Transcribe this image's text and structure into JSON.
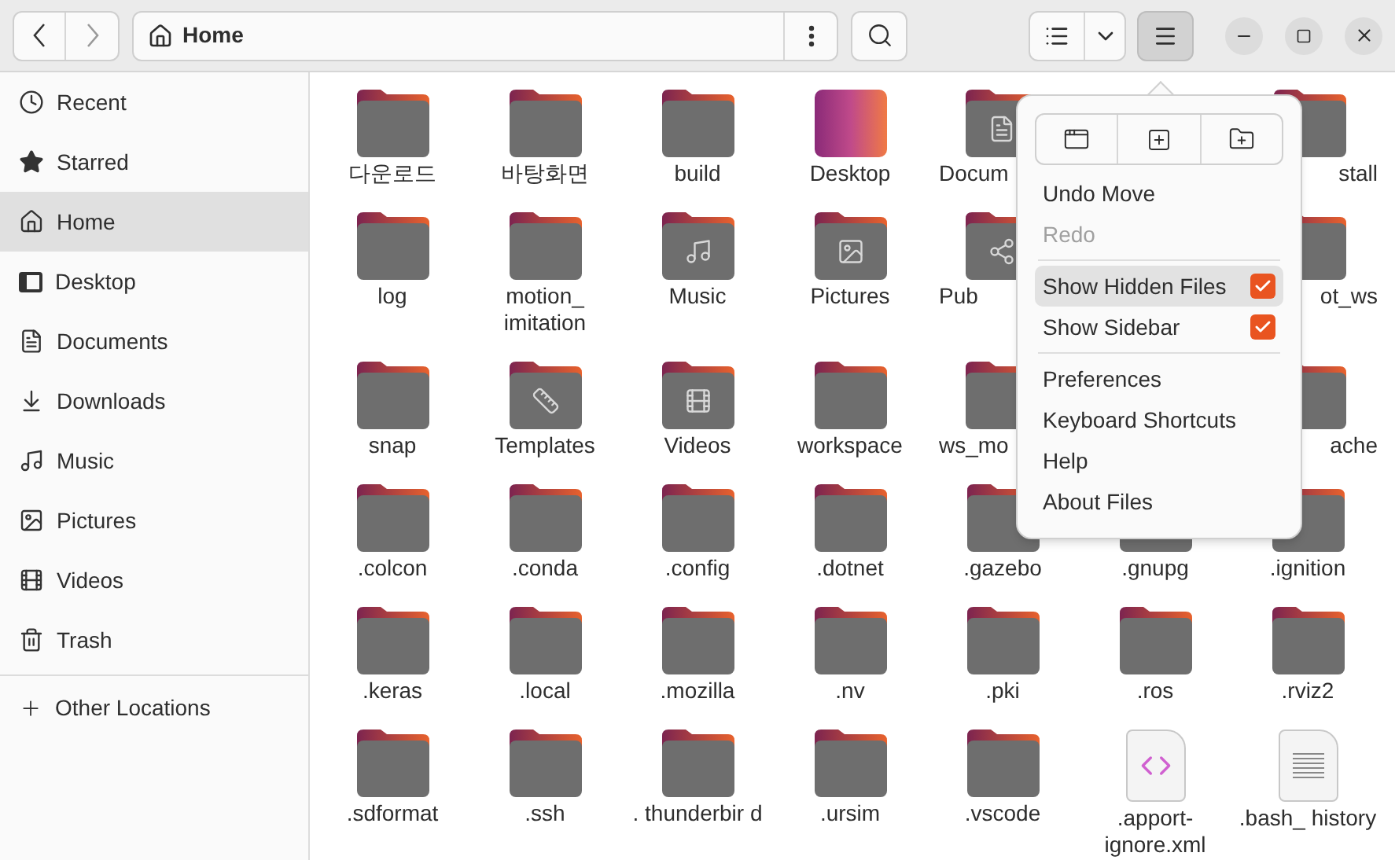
{
  "header": {
    "location": "Home",
    "menu_open": true
  },
  "sidebar": {
    "items": [
      {
        "label": "Recent",
        "kind": "recent",
        "selected": false
      },
      {
        "label": "Starred",
        "kind": "star",
        "selected": false
      },
      {
        "label": "Home",
        "kind": "home",
        "selected": true
      },
      {
        "label": "Desktop",
        "kind": "desktop",
        "selected": false
      },
      {
        "label": "Documents",
        "kind": "document",
        "selected": false
      },
      {
        "label": "Downloads",
        "kind": "download",
        "selected": false
      },
      {
        "label": "Music",
        "kind": "music",
        "selected": false
      },
      {
        "label": "Pictures",
        "kind": "picture",
        "selected": false
      },
      {
        "label": "Videos",
        "kind": "video",
        "selected": false
      },
      {
        "label": "Trash",
        "kind": "trash",
        "selected": false
      }
    ],
    "other": {
      "label": "Other Locations"
    }
  },
  "files": [
    {
      "name": "다운로드",
      "kind": "folder"
    },
    {
      "name": "바탕화면",
      "kind": "folder"
    },
    {
      "name": "build",
      "kind": "folder"
    },
    {
      "name": "Desktop",
      "kind": "desktop"
    },
    {
      "name": "Docum",
      "kind": "folder-document"
    },
    {
      "name": "stall",
      "kind": "folder"
    },
    {
      "name": "log",
      "kind": "folder"
    },
    {
      "name": "motion_ imitation",
      "kind": "folder"
    },
    {
      "name": "Music",
      "kind": "folder-music"
    },
    {
      "name": "Pictures",
      "kind": "folder-picture"
    },
    {
      "name": "Pub",
      "kind": "folder-share"
    },
    {
      "name": "ot_ws",
      "kind": "folder"
    },
    {
      "name": "snap",
      "kind": "folder"
    },
    {
      "name": "Templates",
      "kind": "folder-template"
    },
    {
      "name": "Videos",
      "kind": "folder-video"
    },
    {
      "name": "workspace",
      "kind": "folder"
    },
    {
      "name": "ws_mo",
      "kind": "folder"
    },
    {
      "name": "ache",
      "kind": "folder"
    },
    {
      "name": ".colcon",
      "kind": "folder"
    },
    {
      "name": ".conda",
      "kind": "folder"
    },
    {
      "name": ".config",
      "kind": "folder"
    },
    {
      "name": ".dotnet",
      "kind": "folder"
    },
    {
      "name": ".gazebo",
      "kind": "folder"
    },
    {
      "name": ".gnupg",
      "kind": "folder"
    },
    {
      "name": ".ignition",
      "kind": "folder"
    },
    {
      "name": ".keras",
      "kind": "folder"
    },
    {
      "name": ".local",
      "kind": "folder"
    },
    {
      "name": ".mozilla",
      "kind": "folder"
    },
    {
      "name": ".nv",
      "kind": "folder"
    },
    {
      "name": ".pki",
      "kind": "folder"
    },
    {
      "name": ".ros",
      "kind": "folder"
    },
    {
      "name": ".rviz2",
      "kind": "folder"
    },
    {
      "name": ".sdformat",
      "kind": "folder"
    },
    {
      "name": ".ssh",
      "kind": "folder"
    },
    {
      "name": ". thunderbir d",
      "kind": "folder"
    },
    {
      "name": ".ursim",
      "kind": "folder"
    },
    {
      "name": ".vscode",
      "kind": "folder"
    },
    {
      "name": ".apport- ignore.xml",
      "kind": "file-code"
    },
    {
      "name": ".bash_ history",
      "kind": "file-text"
    }
  ],
  "menu": {
    "items": [
      {
        "label": "Undo Move",
        "kind": "action",
        "disabled": false
      },
      {
        "label": "Redo",
        "kind": "action",
        "disabled": true
      },
      {
        "kind": "separator"
      },
      {
        "label": "Show Hidden Files",
        "kind": "check",
        "checked": true,
        "selected": true
      },
      {
        "label": "Show Sidebar",
        "kind": "check",
        "checked": true,
        "selected": false
      },
      {
        "kind": "separator"
      },
      {
        "label": "Preferences",
        "kind": "action",
        "disabled": false
      },
      {
        "label": "Keyboard Shortcuts",
        "kind": "action",
        "disabled": false
      },
      {
        "label": "Help",
        "kind": "action",
        "disabled": false
      },
      {
        "label": "About Files",
        "kind": "action",
        "disabled": false
      }
    ]
  }
}
